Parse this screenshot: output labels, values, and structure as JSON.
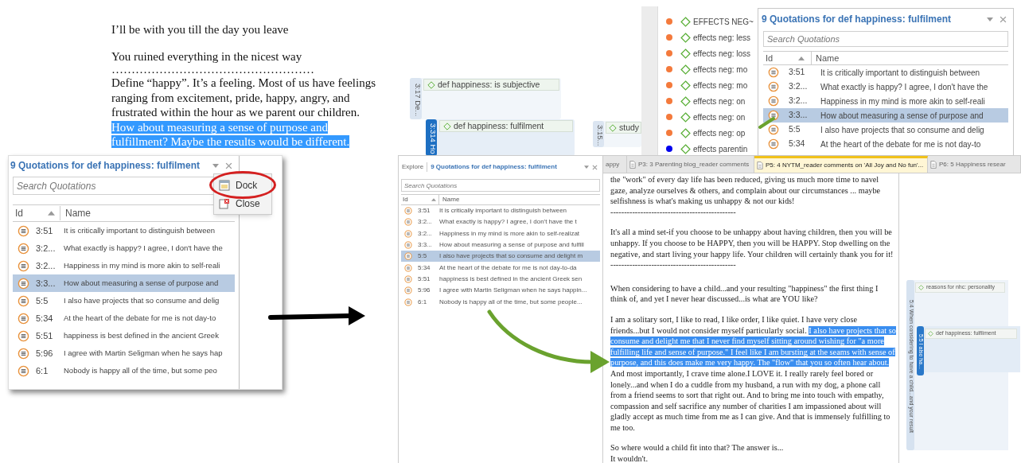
{
  "document_excerpt": {
    "paragraphs": [
      {
        "segments": [
          {
            "text": "I’ll be with you till the day you leave",
            "highlighted": false
          }
        ]
      },
      {
        "segments": [
          {
            "text": "You ruined everything in the nicest way",
            "highlighted": false
          }
        ]
      },
      {
        "segments": [
          {
            "text": "……………………………………………",
            "highlighted": false
          }
        ]
      },
      {
        "segments": [
          {
            "text": "Define “happy”. It’s a feeling. Most of us have feelings ranging from excitement, pride, happy, angry, and frustrated within the hour as we parent our children. ",
            "highlighted": false
          },
          {
            "text": "How about measuring a sense of purpose and fulfillment? Maybe the results would be different.",
            "highlighted": true
          }
        ]
      }
    ]
  },
  "margin_view": {
    "quotations": [
      {
        "label": "3:17 De...",
        "selected": false,
        "codes": [
          "def happiness: is subjective"
        ]
      },
      {
        "label": "3:314 Ho",
        "selected": true,
        "codes": [
          "def happiness: fulfilment"
        ]
      },
      {
        "label": "3:15...",
        "selected": false,
        "codes": [
          "study"
        ]
      }
    ]
  },
  "code_list": {
    "items": [
      {
        "name": "EFFECTS NEG~",
        "color": "#f47a3c"
      },
      {
        "name": "effects neg: less",
        "color": "#f47a3c"
      },
      {
        "name": "effects neg: loss",
        "color": "#f47a3c"
      },
      {
        "name": "effects neg: mo",
        "color": "#f47a3c"
      },
      {
        "name": "effects neg: mo",
        "color": "#f47a3c"
      },
      {
        "name": "effects neg: on",
        "color": "#f47a3c"
      },
      {
        "name": "effects neg: on",
        "color": "#f47a3c"
      },
      {
        "name": "effects neg: op",
        "color": "#f47a3c"
      },
      {
        "name": "effects parentin",
        "color": "#0000ee"
      }
    ]
  },
  "docked_panel": {
    "title": "9 Quotations for def happiness: fulfilment",
    "search_placeholder": "Search Quotations",
    "columns": [
      "Id",
      "Name"
    ],
    "rows": [
      {
        "id": "3:51",
        "name": "It is critically important to distinguish between",
        "selected": false
      },
      {
        "id": "3:2...",
        "name": "What exactly is happy? I agree, I don't have the",
        "selected": false
      },
      {
        "id": "3:2...",
        "name": "Happiness in my mind is more akin to self-reali",
        "selected": false
      },
      {
        "id": "3:3...",
        "name": "How about measuring a sense of purpose and",
        "selected": true
      },
      {
        "id": "5:5",
        "name": "I also have projects that so consume and delig",
        "selected": false
      },
      {
        "id": "5:34",
        "name": "At the heart of the debate for me is not day-to",
        "selected": false
      }
    ]
  },
  "floating_panel": {
    "title": "9 Quotations for def happiness: fulfilment",
    "search_placeholder": "Search Quotations",
    "columns": [
      "Id",
      "Name"
    ],
    "rows": [
      {
        "id": "3:51",
        "name": "It is critically important to distinguish between",
        "selected": false
      },
      {
        "id": "3:2...",
        "name": "What exactly is happy? I agree, I don't have the",
        "selected": false
      },
      {
        "id": "3:2...",
        "name": "Happiness in my mind is more akin to self-reali",
        "selected": false
      },
      {
        "id": "3:3...",
        "name": "How about measuring a sense of purpose and",
        "selected": true
      },
      {
        "id": "5:5",
        "name": "I also have projects that so consume and delig",
        "selected": false
      },
      {
        "id": "5:34",
        "name": "At the heart of the debate for me is not day-to",
        "selected": false
      },
      {
        "id": "5:51",
        "name": "happiness is best defined in the ancient Greek",
        "selected": false
      },
      {
        "id": "5:96",
        "name": "I agree with Martin Seligman when he says hap",
        "selected": false
      },
      {
        "id": "6:1",
        "name": "Nobody is happy all of the time, but some peo",
        "selected": false
      }
    ],
    "menu": [
      {
        "label": "Dock",
        "kind": "dock",
        "highlighted": true
      },
      {
        "label": "Close",
        "kind": "close",
        "highlighted": false
      }
    ]
  },
  "workspace": {
    "panel": {
      "tabs": [
        "Explore"
      ],
      "title": "9 Quotations for def happiness: fulfilment",
      "search_placeholder": "Search Quotations",
      "columns": [
        "Id",
        "Name"
      ],
      "rows": [
        {
          "id": "3:51",
          "name": "It is critically important to distinguish between",
          "selected": false
        },
        {
          "id": "3:2...",
          "name": "What exactly is happy? I agree, I don't have the t",
          "selected": false
        },
        {
          "id": "3:2...",
          "name": "Happiness in my mind is more akin to self-realizat",
          "selected": false
        },
        {
          "id": "3:3...",
          "name": "How about measuring a sense of purpose and fulfill",
          "selected": false
        },
        {
          "id": "5:5",
          "name": "I also have projects that so consume and delight m",
          "selected": true
        },
        {
          "id": "5:34",
          "name": "At the heart of the debate for me is not day-to-da",
          "selected": false
        },
        {
          "id": "5:51",
          "name": "happiness is best defined in the ancient Greek sen",
          "selected": false
        },
        {
          "id": "5:96",
          "name": "I agree with Martin Seligman when he says happin...",
          "selected": false
        },
        {
          "id": "6:1",
          "name": "Nobody is happy all of the time, but some people...",
          "selected": false
        }
      ]
    },
    "document_tabs": [
      {
        "label": "appy",
        "selected": false
      },
      {
        "label": "P3: 3 Parenting blog_reader comments",
        "selected": false
      },
      {
        "label": "P5: 4 NYTM_reader comments on 'All Joy and No fun'...",
        "selected": true
      },
      {
        "label": "P6: 5 Happiness resear",
        "selected": false
      }
    ],
    "document": {
      "paragraphs": [
        {
          "segments": [
            {
              "text": "the \"work\" of every day life has been reduced, giving us much more time to navel gaze, analyze ourselves & others, and complain about our circumstances ... maybe selfishness is what's making us unhappy & not our kids!",
              "highlighted": false
            }
          ]
        },
        {
          "segments": [
            {
              "text": "----------------------------------------------",
              "highlighted": false
            }
          ]
        },
        {
          "segments": [
            {
              "text": "It's all a mind set-if you choose to be unhappy about having children, then you will be unhappy. If you choose to be HAPPY, then you will be HAPPY. Stop dwelling on the negative, and start living your happy life. Your children will certainly thank you for it!",
              "highlighted": false
            }
          ]
        },
        {
          "segments": [
            {
              "text": "----------------------------------------------",
              "highlighted": false
            }
          ]
        },
        {
          "segments": [
            {
              "text": "When considering to have a child...and your resulting \"happiness\" the first thing I think of, and yet I never hear discussed...is what are YOU like?",
              "highlighted": false
            }
          ]
        },
        {
          "segments": [
            {
              "text": "I am a solitary sort, I like to read, I like order, I like quiet. I have very close friends...but I would not consider myself particularly social. ",
              "highlighted": false
            },
            {
              "text": "I also have projects that so consume and delight me that I never find myself sitting around wishing for \"a more fulfilling life and sense of purpose.\" I feel like I am bursting at the seams with sense of purpose, and this does make me very happy. The \"flow\" that you so often hear about.",
              "highlighted": true
            },
            {
              "text": " And most importantly, I crave time alone.I LOVE it. I really rarely feel bored or lonely...and when I do a cuddle from my husband, a run with my dog, a phone call from a friend seems to sort that right out. And to bring me into touch with empathy, compassion and self sacrifice any number of charities I am impassioned about will gladly accept as much time from me as I can give. And that is immensely fulfilling to me too.",
              "highlighted": false
            }
          ]
        },
        {
          "segments": [
            {
              "text": "So where would a child fit into that? The answer is...",
              "highlighted": false
            }
          ]
        },
        {
          "segments": [
            {
              "text": "It wouldn't.",
              "highlighted": false
            }
          ]
        }
      ]
    },
    "margin": {
      "quotations": [
        {
          "label": "5:4 When considering to have a child...and your result",
          "selected": false,
          "codes": [
            "reasons for nhc: personality"
          ]
        },
        {
          "label": "5:5 I also ha...",
          "selected": true,
          "codes": [
            "def happiness: fulfilment"
          ]
        }
      ]
    }
  }
}
